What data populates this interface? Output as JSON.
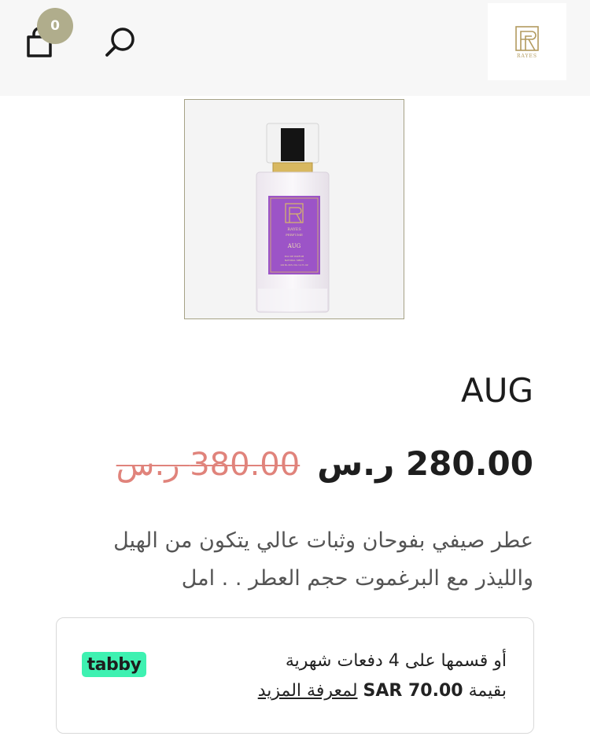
{
  "header": {
    "cart_count": "0",
    "cart_icon": "shopping-bag-icon",
    "search_icon": "search-icon",
    "logo_text": "RAYES",
    "logo_color": "#b29a5e"
  },
  "product": {
    "title": "AUG",
    "price_new": "280.00 ر.س",
    "price_old": "380.00 ر.س",
    "description": "عطر صيفي بفوحان وثبات عالي يتكون من الهيل والليذر مع البرغموت حجم العطر . . امل",
    "bottle_label": {
      "brand": "RAYES",
      "sub": "PERFUME",
      "name": "AUG",
      "small1": "EAU DE PARFUM",
      "small2": "NATURAL SPRAY",
      "small3": "100 ML   80% VOL   3.4 FL OZ"
    }
  },
  "tabby": {
    "line1": "أو قسمها على 4 دفعات شهرية",
    "line2_prefix": "بقيمة",
    "amount": "SAR 70.00",
    "link": "لمعرفة المزيد",
    "logo": "tabby",
    "logo_color": "#3ef1b1"
  },
  "colors": {
    "badge": "#b0ad8c",
    "old_price": "#e0837b",
    "label_purple": "#9c54c7"
  }
}
